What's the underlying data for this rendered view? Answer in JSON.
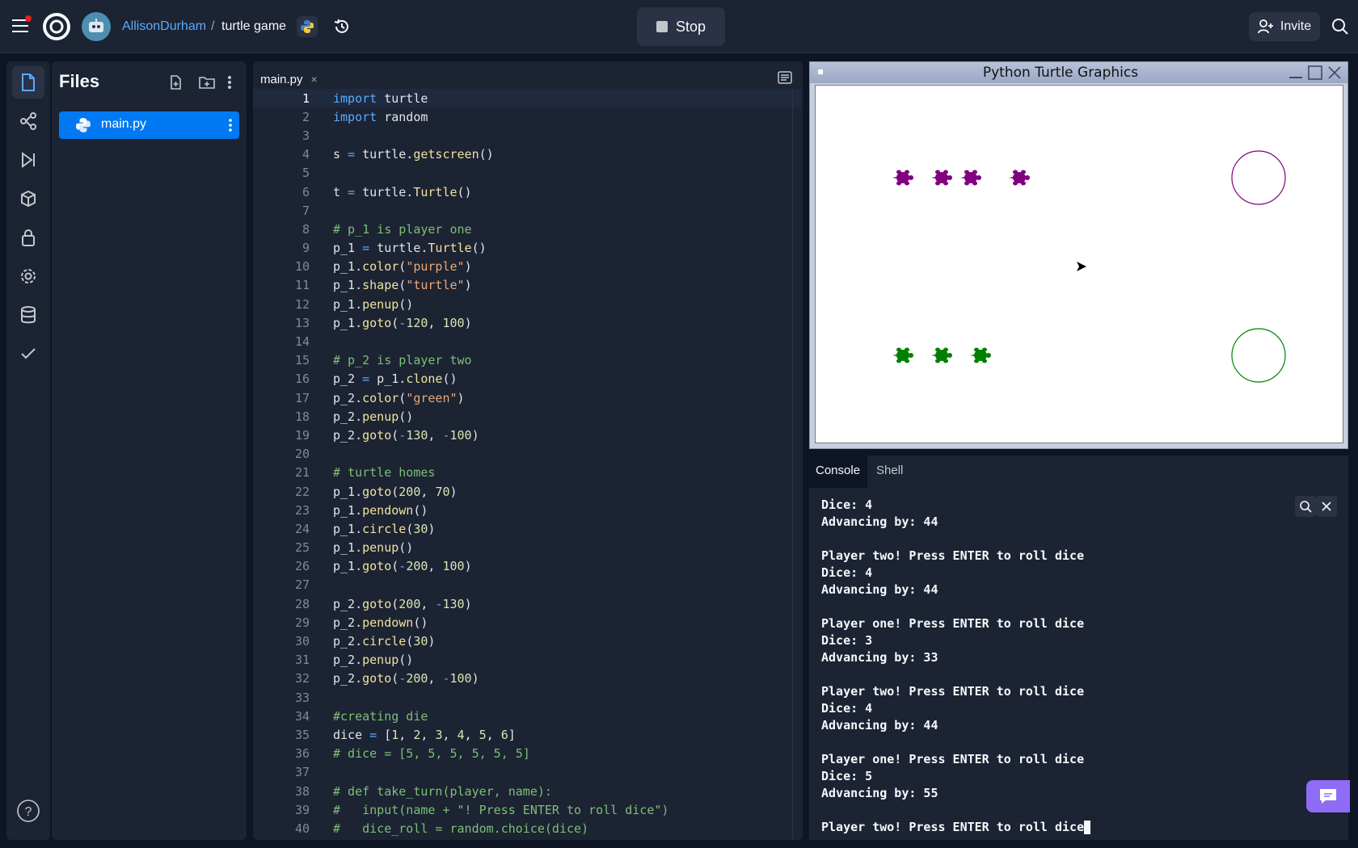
{
  "topbar": {
    "owner": "AllisonDurham",
    "separator": "/",
    "project": "turtle game",
    "stop_label": "Stop",
    "invite_label": "Invite"
  },
  "files": {
    "title": "Files",
    "items": [
      {
        "name": "main.py",
        "icon": "python-icon"
      }
    ]
  },
  "editor": {
    "tab_label": "main.py",
    "tab_close": "×",
    "lines": [
      "1",
      "2",
      "3",
      "4",
      "5",
      "6",
      "7",
      "8",
      "9",
      "10",
      "11",
      "12",
      "13",
      "14",
      "15",
      "16",
      "17",
      "18",
      "19",
      "20",
      "21",
      "22",
      "23",
      "24",
      "25",
      "26",
      "27",
      "28",
      "29",
      "30",
      "31",
      "32",
      "33",
      "34",
      "35",
      "36",
      "37",
      "38",
      "39",
      "40"
    ],
    "code": [
      "import turtle",
      "import random",
      "",
      "s = turtle.getscreen()",
      "",
      "t = turtle.Turtle()",
      "",
      "# p_1 is player one",
      "p_1 = turtle.Turtle()",
      "p_1.color(\"purple\")",
      "p_1.shape(\"turtle\")",
      "p_1.penup()",
      "p_1.goto(-120, 100)",
      "",
      "# p_2 is player two",
      "p_2 = p_1.clone()",
      "p_2.color(\"green\")",
      "p_2.penup()",
      "p_2.goto(-130, -100)",
      "",
      "# turtle homes",
      "p_1.goto(200, 70)",
      "p_1.pendown()",
      "p_1.circle(30)",
      "p_1.penup()",
      "p_1.goto(-200, 100)",
      "",
      "p_2.goto(200, -130)",
      "p_2.pendown()",
      "p_2.circle(30)",
      "p_2.penup()",
      "p_2.goto(-200, -100)",
      "",
      "#creating die",
      "dice = [1, 2, 3, 4, 5, 6]",
      "# dice = [5, 5, 5, 5, 5, 5]",
      "",
      "# def take_turn(player, name):",
      "#   input(name + \"! Press ENTER to roll dice\")",
      "#   dice_roll = random.choice(dice)"
    ]
  },
  "turtle_window": {
    "title": "Python Turtle Graphics",
    "p1_color": "#800080",
    "p2_color": "#008000"
  },
  "console": {
    "tabs": [
      "Console",
      "Shell"
    ],
    "lines": [
      "Dice: 4",
      "Advancing by: 44",
      "",
      "Player two! Press ENTER to roll dice",
      "Dice: 4",
      "Advancing by: 44",
      "",
      "Player one! Press ENTER to roll dice",
      "Dice: 3",
      "Advancing by: 33",
      "",
      "Player two! Press ENTER to roll dice",
      "Dice: 4",
      "Advancing by: 44",
      "",
      "Player one! Press ENTER to roll dice",
      "Dice: 5",
      "Advancing by: 55",
      "",
      "Player two! Press ENTER to roll dice"
    ]
  }
}
